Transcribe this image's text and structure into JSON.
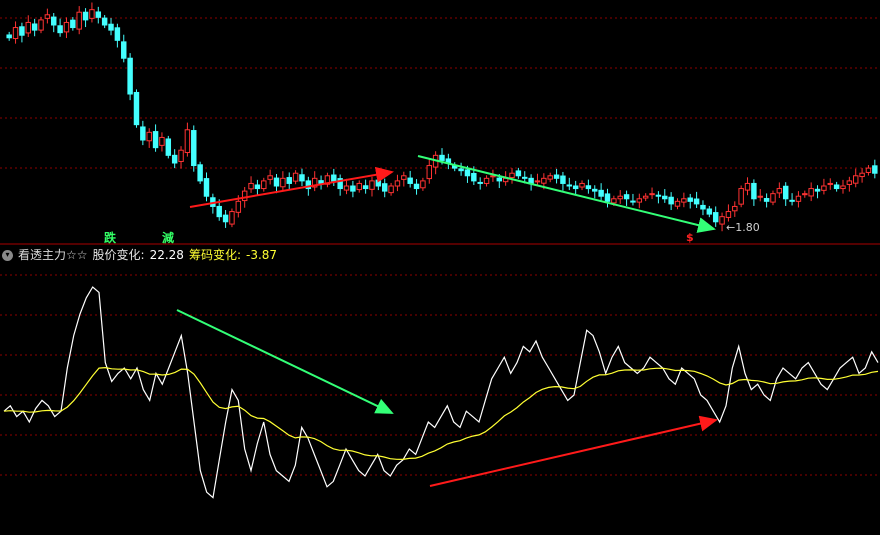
{
  "indicator": {
    "name": "看透主力☆☆",
    "price_change_label": "股价变化:",
    "price_change_value": "22.28",
    "chip_change_label": "筹码变化:",
    "chip_change_value": "-3.87"
  },
  "signals": {
    "die": "跌",
    "jian": "減",
    "s_mark": "$",
    "low_label": "←1.80"
  },
  "colors": {
    "up": "#ff3333",
    "down": "#44ffff",
    "grid": "#8b0000",
    "white_line": "#ffffff",
    "yellow_line": "#ffff33",
    "arrow_red": "#ff1a1a",
    "arrow_green": "#33ff77",
    "die_color": "#33ff66",
    "jian_color": "#33ff66"
  },
  "chart_data": [
    {
      "type": "candlestick",
      "title": "",
      "trend_arrows": [
        {
          "direction": "up",
          "color": "red"
        },
        {
          "direction": "down",
          "color": "green"
        }
      ],
      "low_marker": 1.8,
      "closes": [
        9.2,
        9.6,
        9.3,
        9.8,
        9.5,
        9.9,
        10.1,
        9.7,
        9.4,
        9.8,
        9.6,
        10.2,
        9.9,
        10.3,
        10.0,
        9.7,
        9.5,
        9.1,
        8.4,
        7.0,
        5.8,
        5.2,
        5.5,
        4.9,
        5.3,
        4.6,
        4.3,
        4.8,
        5.6,
        4.2,
        3.6,
        3.0,
        2.6,
        2.2,
        2.0,
        2.4,
        2.8,
        3.2,
        3.5,
        3.3,
        3.6,
        3.8,
        3.4,
        3.7,
        3.5,
        3.9,
        3.6,
        3.3,
        3.7,
        3.5,
        3.8,
        3.6,
        3.3,
        3.4,
        3.2,
        3.5,
        3.3,
        3.6,
        3.4,
        3.2,
        3.4,
        3.6,
        3.8,
        3.5,
        3.3,
        3.6,
        4.2,
        4.6,
        4.4,
        4.3,
        4.1,
        4.0,
        3.8,
        3.6,
        3.5,
        3.7,
        3.8,
        3.6,
        3.7,
        3.9,
        3.8,
        3.7,
        3.5,
        3.6,
        3.7,
        3.8,
        3.7,
        3.5,
        3.4,
        3.3,
        3.5,
        3.3,
        3.2,
        3.0,
        2.8,
        2.9,
        3.0,
        2.9,
        2.8,
        2.9,
        3.0,
        3.1,
        3.0,
        2.9,
        2.7,
        2.8,
        2.9,
        2.8,
        2.7,
        2.5,
        2.3,
        2.0,
        2.2,
        2.4,
        2.6,
        3.3,
        3.5,
        2.9,
        3.0,
        2.8,
        3.1,
        3.3,
        2.9,
        2.8,
        3.0,
        3.1,
        3.3,
        3.2,
        3.4,
        3.5,
        3.3,
        3.4,
        3.6,
        3.8,
        3.9,
        4.1,
        3.9
      ],
      "sub_white": [
        44,
        46,
        42,
        44,
        40,
        45,
        48,
        46,
        42,
        44,
        60,
        72,
        80,
        86,
        90,
        88,
        62,
        55,
        58,
        60,
        56,
        60,
        52,
        48,
        58,
        54,
        60,
        66,
        72,
        58,
        40,
        22,
        14,
        12,
        26,
        40,
        52,
        48,
        30,
        22,
        32,
        40,
        28,
        22,
        20,
        18,
        24,
        38,
        34,
        28,
        22,
        16,
        18,
        24,
        30,
        26,
        22,
        20,
        24,
        28,
        22,
        20,
        24,
        26,
        30,
        28,
        34,
        40,
        38,
        42,
        46,
        40,
        38,
        44,
        42,
        40,
        48,
        56,
        60,
        64,
        58,
        62,
        68,
        66,
        70,
        64,
        60,
        56,
        52,
        48,
        50,
        62,
        74,
        72,
        66,
        58,
        64,
        68,
        62,
        60,
        58,
        60,
        64,
        62,
        60,
        56,
        54,
        60,
        58,
        56,
        50,
        48,
        44,
        40,
        46,
        60,
        68,
        58,
        52,
        54,
        50,
        48,
        56,
        60,
        58,
        56,
        60,
        62,
        58,
        54,
        52,
        56,
        60,
        62,
        64,
        58,
        60,
        66,
        62
      ]
    }
  ]
}
